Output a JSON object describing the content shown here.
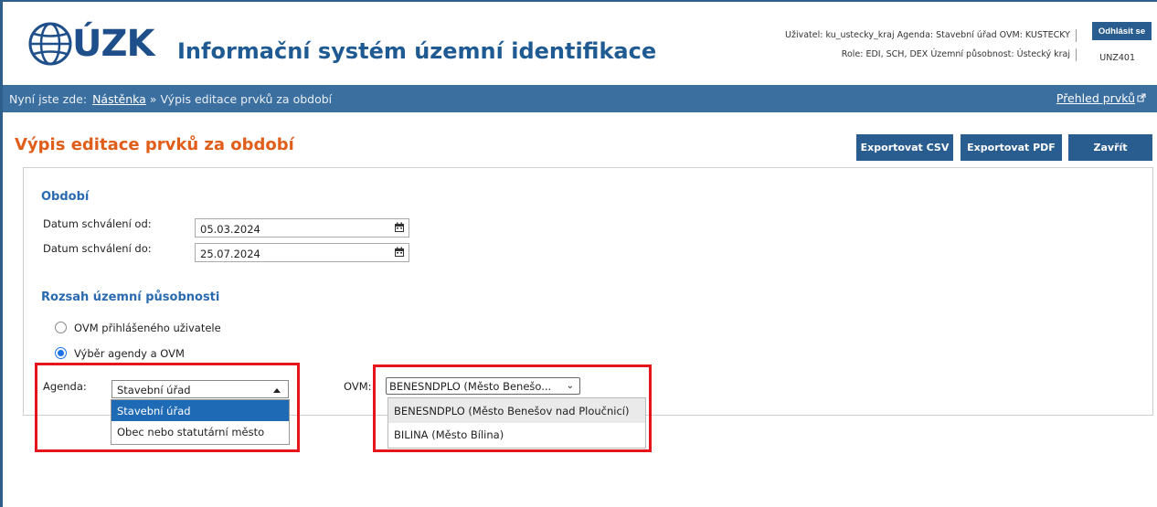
{
  "header": {
    "logo_text": "ÚZK",
    "app_title": "Informační systém územní identifikace",
    "user_line1": "Uživatel: ku_ustecky_kraj   Agenda: Stavební úřad   OVM: KUSTECKY",
    "user_line2": "Role: EDI, SCH, DEX   Územní působnost: Ústecký kraj",
    "logout_label": "Odhlásit se",
    "user_code": "UNZ401"
  },
  "navbar": {
    "prefix": "Nyní jste zde:",
    "crumb_home": "Nástěnka",
    "crumb_sep": "»",
    "crumb_current": "Výpis editace prvků za období",
    "overview_link": "Přehled prvků"
  },
  "page": {
    "title": "Výpis editace prvků za období",
    "export_csv": "Exportovat CSV",
    "export_pdf": "Exportovat PDF",
    "close": "Zavřít"
  },
  "period": {
    "title": "Období",
    "from_label": "Datum schválení od:",
    "from_value": "05.03.2024",
    "to_label": "Datum schválení do:",
    "to_value": "25.07.2024"
  },
  "scope": {
    "title": "Rozsah územní působnosti",
    "option_user": "OVM přihlášeného uživatele",
    "option_agenda": "Výběr agendy a OVM",
    "selected": "Výběr agendy a OVM"
  },
  "agenda": {
    "label": "Agenda:",
    "value": "Stavební úřad",
    "options": [
      "Stavební úřad",
      "Obec nebo statutární město"
    ]
  },
  "ovm": {
    "label": "OVM:",
    "value": "BENESNDPLO (Město Benešo...",
    "options": [
      "BENESNDPLO (Město Benešov nad Ploučnicí)",
      "BILINA (Město Bílina)"
    ]
  },
  "colors": {
    "brand": "#1f5b92",
    "nav": "#3b6fa0",
    "title_accent": "#e05d1a",
    "button": "#2a5d8f",
    "highlight": "#e8141b"
  }
}
